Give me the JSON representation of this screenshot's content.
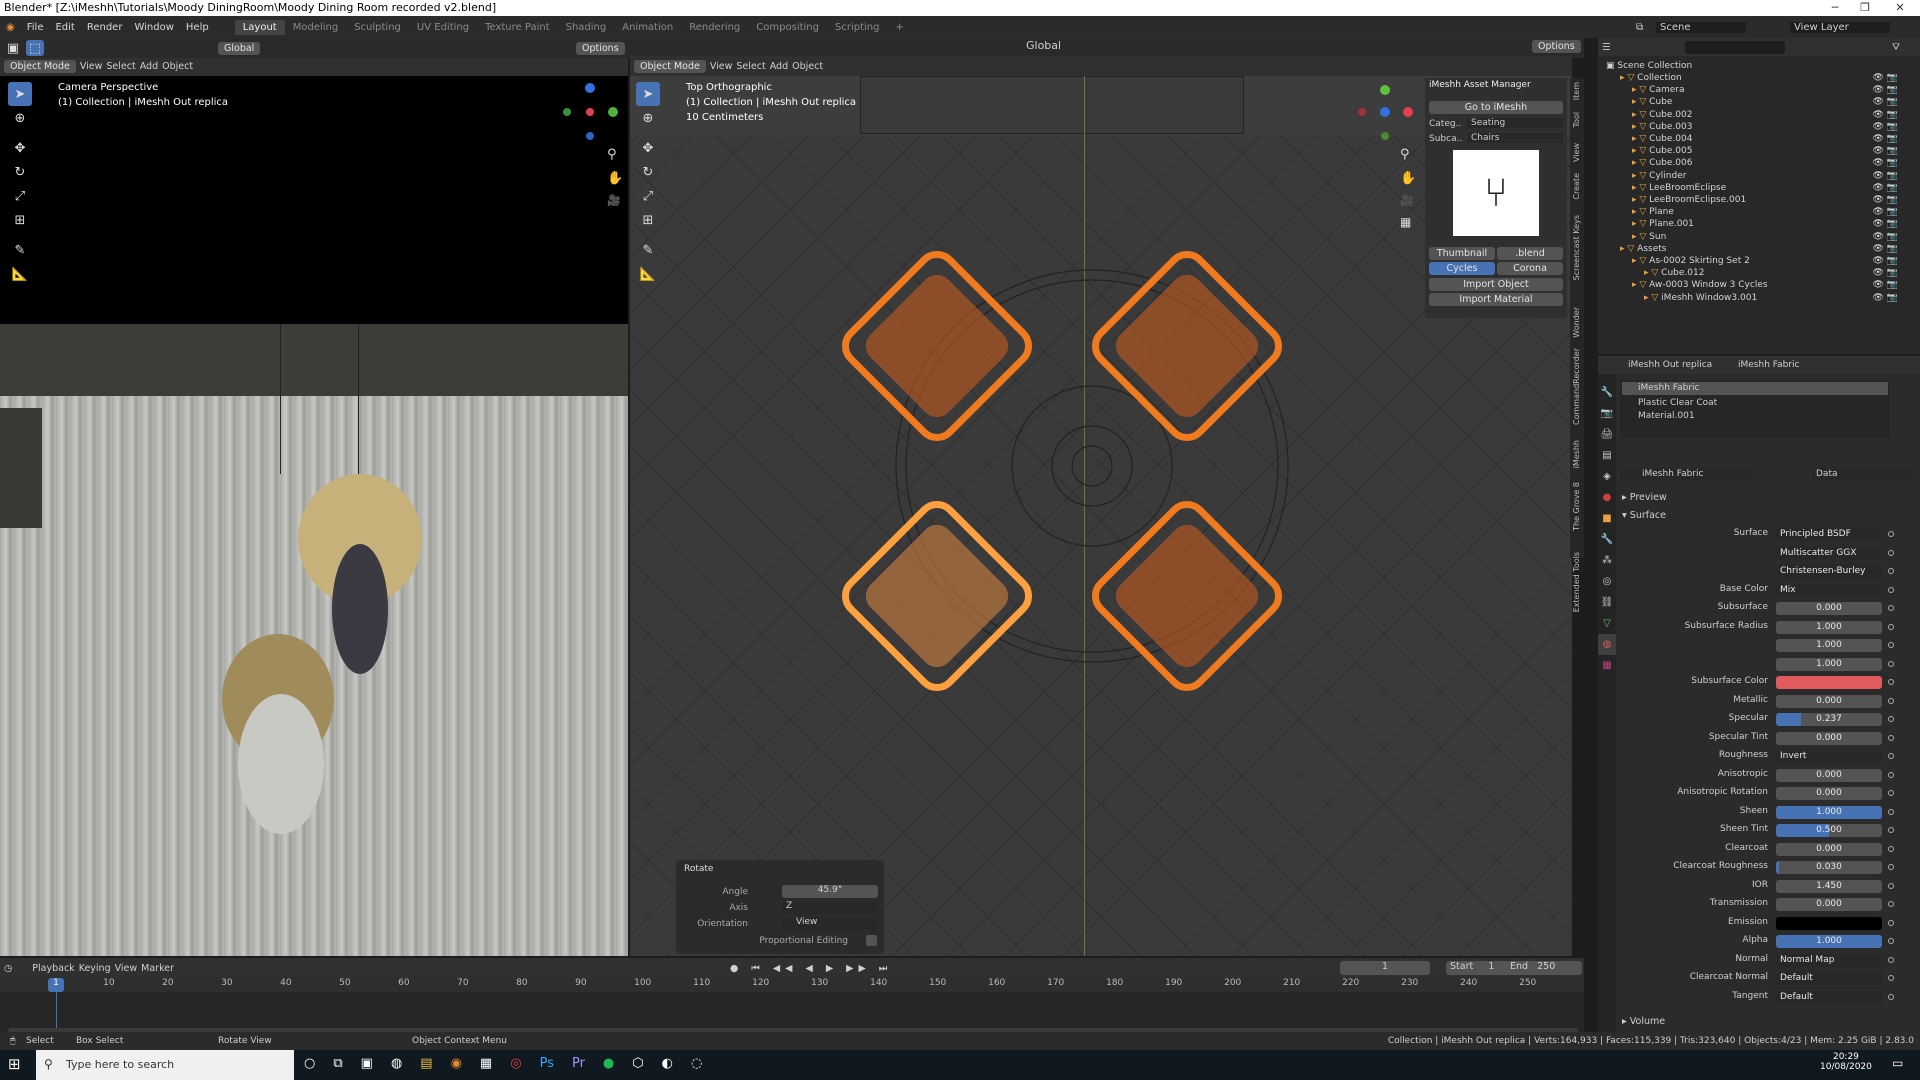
{
  "window": {
    "title": "Blender* [Z:\\iMeshh\\Tutorials\\Moody DiningRoom\\Moody Dining Room recorded v2.blend]"
  },
  "menu": {
    "items": [
      "File",
      "Edit",
      "Render",
      "Window",
      "Help"
    ]
  },
  "workspaces": [
    "Layout",
    "Modeling",
    "Sculpting",
    "UV Editing",
    "Texture Paint",
    "Shading",
    "Animation",
    "Rendering",
    "Compositing",
    "Scripting"
  ],
  "top_right": {
    "scene": "Scene",
    "view_layer": "View Layer"
  },
  "header_global": {
    "transform": "Global",
    "options": "Options"
  },
  "left_viewport": {
    "mode": "Object Mode",
    "menus": [
      "View",
      "Select",
      "Add",
      "Object"
    ],
    "overlay_title": "Camera Perspective",
    "overlay_collection": "(1) Collection | iMeshh Out replica"
  },
  "main_viewport": {
    "mode": "Object Mode",
    "menus": [
      "View",
      "Select",
      "Add",
      "Object"
    ],
    "transform": "Global",
    "options": "Options",
    "overlay_title": "Top Orthographic",
    "overlay_collection": "(1) Collection | iMeshh Out replica",
    "overlay_scale": "10 Centimeters"
  },
  "asset_manager": {
    "title": "iMeshh Asset Manager",
    "goto": "Go to iMeshh",
    "category_label": "Categ..",
    "category_value": "Seating",
    "subcategory_label": "Subca..",
    "subcategory_value": "Chairs",
    "thumb_tab": "Thumbnail",
    "blend_tab": ".blend",
    "engine_cycles": "Cycles",
    "engine_corona": "Corona",
    "import_object": "Import Object",
    "import_material": "Import Material"
  },
  "side_tabs": [
    "Item",
    "Tool",
    "View",
    "Create",
    "Screencast Keys",
    "Wonder",
    "CommandRecorder",
    "iMeshh",
    "The Grove 8",
    "Extended Tools"
  ],
  "rotate_panel": {
    "title": "Rotate",
    "angle_label": "Angle",
    "angle_value": "45.9°",
    "axis_label": "Axis",
    "axis_value": "Z",
    "orientation_label": "Orientation",
    "orientation_value": "View",
    "proportional_label": "Proportional Editing"
  },
  "outliner": {
    "root": "Scene Collection",
    "rows": [
      {
        "label": "Collection",
        "indent": 1
      },
      {
        "label": "Camera",
        "indent": 2
      },
      {
        "label": "Cube",
        "indent": 2
      },
      {
        "label": "Cube.002",
        "indent": 2
      },
      {
        "label": "Cube.003",
        "indent": 2
      },
      {
        "label": "Cube.004",
        "indent": 2
      },
      {
        "label": "Cube.005",
        "indent": 2
      },
      {
        "label": "Cube.006",
        "indent": 2
      },
      {
        "label": "Cylinder",
        "indent": 2
      },
      {
        "label": "LeeBroomEclipse",
        "indent": 2
      },
      {
        "label": "LeeBroomEclipse.001",
        "indent": 2
      },
      {
        "label": "Plane",
        "indent": 2
      },
      {
        "label": "Plane.001",
        "indent": 2
      },
      {
        "label": "Sun",
        "indent": 2
      },
      {
        "label": "Assets",
        "indent": 1
      },
      {
        "label": "As-0002 Skirting Set 2",
        "indent": 2
      },
      {
        "label": "Cube.012",
        "indent": 3
      },
      {
        "label": "Aw-0003 Window 3 Cycles",
        "indent": 2
      },
      {
        "label": "iMeshh Window3.001",
        "indent": 3
      }
    ]
  },
  "properties": {
    "object": "iMeshh Out replica",
    "material_tab": "iMeshh Fabric",
    "slots": [
      "iMeshh Fabric",
      "Plastic Clear Coat",
      "Material.001"
    ],
    "material_name": "iMeshh Fabric",
    "data_dropdown": "Data",
    "preview": "Preview",
    "surface_section": "Surface",
    "volume_section": "Volume",
    "rows": [
      {
        "label": "Surface",
        "value": "Principled BSDF",
        "kind": "dd"
      },
      {
        "label": "",
        "value": "Multiscatter GGX",
        "kind": "dd"
      },
      {
        "label": "",
        "value": "Christensen-Burley",
        "kind": "dd"
      },
      {
        "label": "Base Color",
        "value": "Mix",
        "kind": "dd"
      },
      {
        "label": "Subsurface",
        "value": "0.000",
        "kind": "num"
      },
      {
        "label": "Subsurface Radius",
        "value": "1.000",
        "kind": "num"
      },
      {
        "label": "",
        "value": "1.000",
        "kind": "num"
      },
      {
        "label": "",
        "value": "1.000",
        "kind": "num"
      },
      {
        "label": "Subsurface Color",
        "value": "",
        "kind": "color",
        "color": "#e05a5e"
      },
      {
        "label": "Metallic",
        "value": "0.000",
        "kind": "num"
      },
      {
        "label": "Specular",
        "value": "0.237",
        "kind": "num",
        "fill": 0.237
      },
      {
        "label": "Specular Tint",
        "value": "0.000",
        "kind": "num"
      },
      {
        "label": "Roughness",
        "value": "Invert",
        "kind": "dd"
      },
      {
        "label": "Anisotropic",
        "value": "0.000",
        "kind": "num"
      },
      {
        "label": "Anisotropic Rotation",
        "value": "0.000",
        "kind": "num"
      },
      {
        "label": "Sheen",
        "value": "1.000",
        "kind": "num",
        "fill": 1.0
      },
      {
        "label": "Sheen Tint",
        "value": "0.500",
        "kind": "num",
        "fill": 0.5
      },
      {
        "label": "Clearcoat",
        "value": "0.000",
        "kind": "num"
      },
      {
        "label": "Clearcoat Roughness",
        "value": "0.030",
        "kind": "num",
        "fill": 0.03
      },
      {
        "label": "IOR",
        "value": "1.450",
        "kind": "num"
      },
      {
        "label": "Transmission",
        "value": "0.000",
        "kind": "num"
      },
      {
        "label": "Emission",
        "value": "",
        "kind": "color",
        "color": "#000000"
      },
      {
        "label": "Alpha",
        "value": "1.000",
        "kind": "num",
        "fill": 1.0
      },
      {
        "label": "Normal",
        "value": "Normal Map",
        "kind": "dd"
      },
      {
        "label": "Clearcoat Normal",
        "value": "Default",
        "kind": "dd"
      },
      {
        "label": "Tangent",
        "value": "Default",
        "kind": "dd"
      }
    ]
  },
  "timeline": {
    "menus": [
      "Playback",
      "Keying",
      "View",
      "Marker"
    ],
    "current_frame": "1",
    "start_label": "Start",
    "start": "1",
    "end_label": "End",
    "end": "250",
    "ticks": [
      "1",
      "10",
      "20",
      "30",
      "40",
      "50",
      "60",
      "70",
      "80",
      "90",
      "100",
      "110",
      "120",
      "130",
      "140",
      "150",
      "160",
      "170",
      "180",
      "190",
      "200",
      "210",
      "220",
      "230",
      "240",
      "250"
    ]
  },
  "status_bar": {
    "select": "Select",
    "box_select": "Box Select",
    "rotate_view": "Rotate View",
    "context_menu": "Object Context Menu",
    "stats": "Collection | iMeshh Out replica | Verts:164,933 | Faces:115,339 | Tris:323,640 | Objects:4/23 | Mem: 2.25 GiB | 2.83.0"
  },
  "taskbar": {
    "search_placeholder": "Type here to search",
    "time": "20:29",
    "date": "10/08/2020"
  },
  "colors": {
    "accent": "#4772b3",
    "selected_orange": "#f07a1e",
    "active_orange": "#ffa040"
  }
}
